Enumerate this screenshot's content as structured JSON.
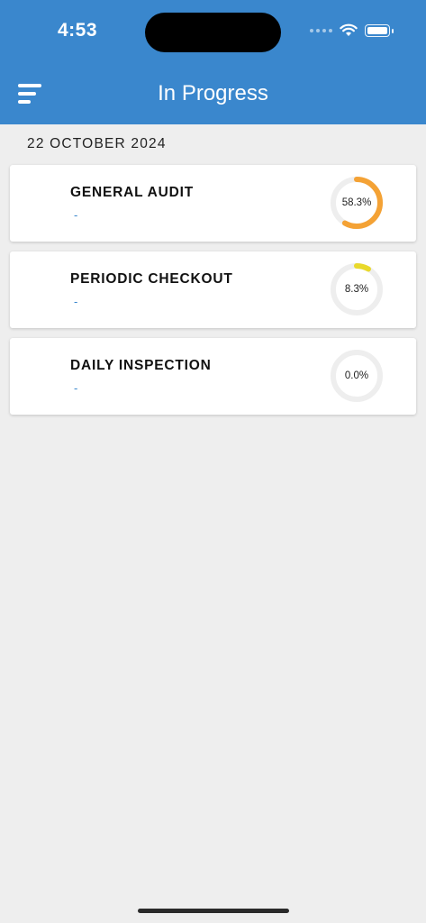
{
  "status_bar": {
    "time": "4:53"
  },
  "header": {
    "title": "In Progress",
    "menu_icon": "menu-bars-icon"
  },
  "date_label": "22 OCTOBER 2024",
  "items": [
    {
      "title": "GENERAL AUDIT",
      "subtitle": "-",
      "progress_label": "58.3%",
      "progress": 0.583,
      "color": "#f4a235"
    },
    {
      "title": "PERIODIC CHECKOUT",
      "subtitle": "-",
      "progress_label": "8.3%",
      "progress": 0.083,
      "color": "#e9d92b"
    },
    {
      "title": "DAILY INSPECTION",
      "subtitle": "-",
      "progress_label": "0.0%",
      "progress": 0.0,
      "color": "#f4a235"
    }
  ],
  "colors": {
    "header_bg": "#3a87cd",
    "page_bg": "#eeeeee",
    "ring_track": "#eeeeee"
  }
}
